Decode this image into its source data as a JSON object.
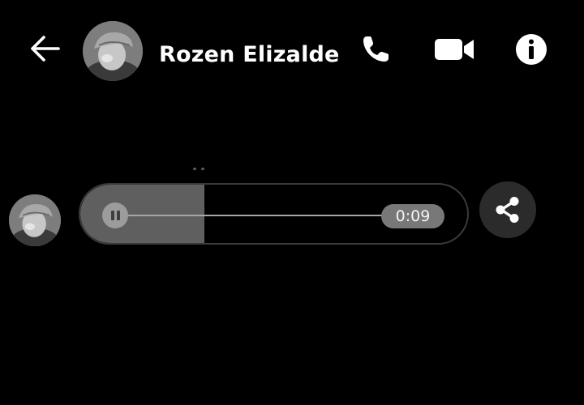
{
  "header": {
    "back_icon": "arrow-left-icon",
    "contact_name": "Rozen Elizalde",
    "actions": {
      "call_icon": "phone-icon",
      "video_icon": "video-camera-icon",
      "info_icon": "info-icon"
    }
  },
  "conversation": {
    "audio_message": {
      "state": "playing",
      "duration": "0:09",
      "progress_fraction": 0.32
    },
    "share_icon": "share-icon"
  },
  "colors": {
    "background": "#000000",
    "text": "#ffffff",
    "progress": "#5f5f5f",
    "share_button": "#2b2b2b"
  }
}
